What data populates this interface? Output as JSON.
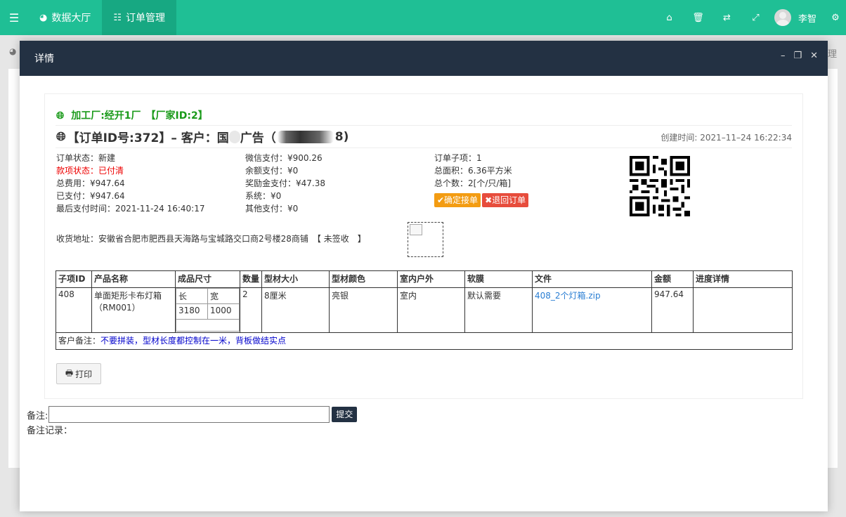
{
  "nav": {
    "dashboard": "数据大厅",
    "orders": "订单管理",
    "user_name": "李智"
  },
  "background": {
    "right_text": "理"
  },
  "modal": {
    "title": "详情"
  },
  "order": {
    "factory": "加工厂:经开1厂　【厂家ID:2】",
    "title_prefix": "【订单ID号:372】– 客户：国",
    "title_mid": "广告（",
    "title_suffix": "8)",
    "created_time": "创建时间: 2021–11–24 16:22:34",
    "col1": [
      {
        "label": "订单状态：",
        "value": "新建",
        "red": false
      },
      {
        "label": "款项状态：",
        "value": "已付清",
        "red": true
      },
      {
        "label": "总费用：",
        "value": "¥947.64",
        "red": false
      },
      {
        "label": "已支付：",
        "value": "¥947.64",
        "red": false
      },
      {
        "label": "最后支付时间：",
        "value": "2021-11-24 16:40:17",
        "red": false
      }
    ],
    "col2": [
      {
        "label": "微信支付：",
        "value": "¥900.26"
      },
      {
        "label": "余额支付：",
        "value": "¥0"
      },
      {
        "label": "奖励金支付：",
        "value": "¥47.38"
      },
      {
        "label": "系统：",
        "value": "¥0"
      },
      {
        "label": "其他支付：",
        "value": "¥0"
      }
    ],
    "col3": [
      {
        "label": "订单子项：",
        "value": "1"
      },
      {
        "label": "总面积：",
        "value": "6.36平方米"
      },
      {
        "label": "总个数：",
        "value": "2[个/只/箱]"
      }
    ],
    "confirm_btn": "✔确定接单",
    "return_btn": "✖退回订单",
    "address": "收货地址：安徽省合肥市肥西县天海路与宝城路交口商2号楼28商铺　【 未签收　】"
  },
  "table": {
    "headers": [
      "子项ID",
      "产品名称",
      "成品尺寸",
      "数量",
      "型材大小",
      "型材颜色",
      "室内户外",
      "软膜",
      "文件",
      "金额",
      "进度详情"
    ],
    "row": {
      "id": "408",
      "name": "单面矩形卡布灯箱（RM001）",
      "len_label": "长",
      "wid_label": "宽",
      "len": "3180",
      "wid": "1000",
      "qty": "2",
      "profile_size": "8厘米",
      "profile_color": "亮银",
      "indoor": "室内",
      "film": "默认需要",
      "file": "408_2个灯箱.zip",
      "amount": "947.64",
      "progress": ""
    },
    "note_label": "客户备注：",
    "note_text": "不要拼装，型材长度都控制在一米，背板做结实点"
  },
  "print_btn": "打印",
  "remark": {
    "label": "备注:",
    "value": "",
    "submit": "提交",
    "log_label": "备注记录："
  }
}
